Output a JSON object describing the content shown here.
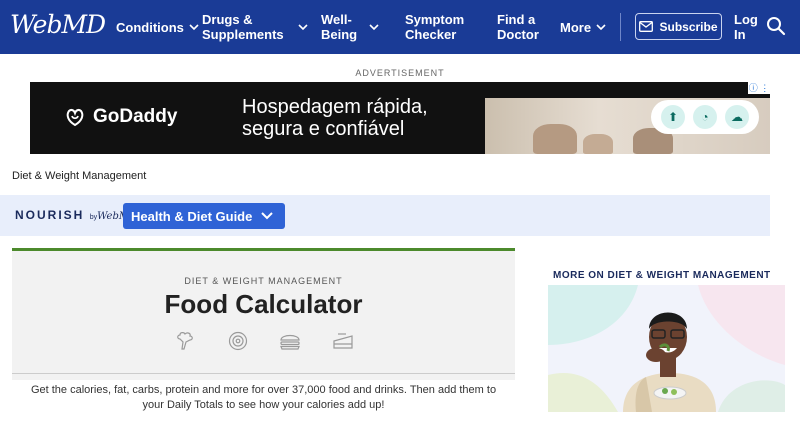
{
  "header": {
    "logo": "WebMD",
    "nav": [
      {
        "label": "Conditions",
        "dropdown": true
      },
      {
        "label": "Drugs & Supplements",
        "dropdown": true
      },
      {
        "label": "Well-Being",
        "dropdown": true
      },
      {
        "label": "Symptom Checker",
        "dropdown": false
      },
      {
        "label": "Find a Doctor",
        "dropdown": false
      },
      {
        "label": "More",
        "dropdown": true
      }
    ],
    "subscribe_label": "Subscribe",
    "login_label": "Log In",
    "brand_color": "#1a3b96"
  },
  "ad": {
    "label": "ADVERTISEMENT",
    "brand": "GoDaddy",
    "headline_line1": "Hospedagem rápida,",
    "headline_line2": "segura e confiável"
  },
  "breadcrumb": "Diet & Weight Management",
  "nourish": {
    "logo": "NOURISH",
    "logo_by": "by",
    "logo_webmd": "WebMD",
    "guide_button": "Health & Diet Guide"
  },
  "card": {
    "eyebrow": "DIET & WEIGHT MANAGEMENT",
    "title": "Food Calculator",
    "description": "Get the calories, fat, carbs, protein and more for over 37,000 food and drinks. Then add them to your Daily Totals to see how your calories add up!",
    "accent_color": "#4c8a2c"
  },
  "sidebar": {
    "title": "MORE ON DIET & WEIGHT MANAGEMENT"
  }
}
